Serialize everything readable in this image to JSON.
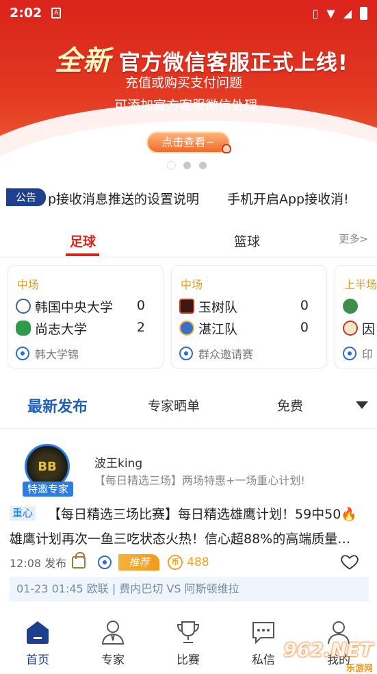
{
  "status_bar": {
    "time": "2:02",
    "notification": "A"
  },
  "banner": {
    "headline_big": "全新",
    "headline_rest": "官方微信客服正式上线!",
    "line1": "充值或购买支付问题",
    "line2": "可添加官方客服微信处理",
    "button": "点击查看~",
    "active_dot": 0
  },
  "notice": {
    "badge": "公告",
    "text1": "p接收消息推送的设置说明",
    "text2": "手机开启App接收消!"
  },
  "sport_tabs": {
    "football": "足球",
    "basketball": "篮球",
    "more": "更多>"
  },
  "matches": [
    {
      "status": "中场",
      "home": "韩国中央大学",
      "home_score": "0",
      "away": "尚志大学",
      "away_score": "2",
      "league": "韩大学锦"
    },
    {
      "status": "中场",
      "home": "玉树队",
      "home_score": "0",
      "away": "湛江队",
      "away_score": "0",
      "league": "群众邀请赛"
    },
    {
      "status": "上半场",
      "home": "",
      "home_score": "",
      "away": "因",
      "away_score": "",
      "league": "印"
    }
  ],
  "content_tabs": {
    "latest": "最新发布",
    "expert": "专家晒单",
    "free": "免费"
  },
  "post": {
    "avatar_text": "BB",
    "expert_badge": "特邀专家",
    "author": "波王king",
    "plan": "【每日精选三场】两场特惠+一场重心计划!",
    "tag": "重心",
    "title_line1": "【每日精选三场比赛】每日精选雄鹰计划！59中50🔥",
    "title_line2": "雄鹰计划再次一鱼三吃状态火热！信心超88%的高端质量…",
    "published": "12:08 发布",
    "recommend": "推荐",
    "coin_label": "币",
    "price": "488",
    "match_info": "01-23 01:45   欧联 | 费内巴切  VS  阿斯顿维拉"
  },
  "bottom_nav": {
    "home": "首页",
    "expert": "专家",
    "match": "比赛",
    "message": "私信",
    "mine": "我的"
  },
  "watermark": {
    "main": "962.NET",
    "sub": "乐游网"
  },
  "colors": {
    "accent_red": "#d6261c",
    "accent_blue": "#1e5fb8",
    "status_orange": "#e59a1c",
    "price_orange": "#f3a21a"
  }
}
